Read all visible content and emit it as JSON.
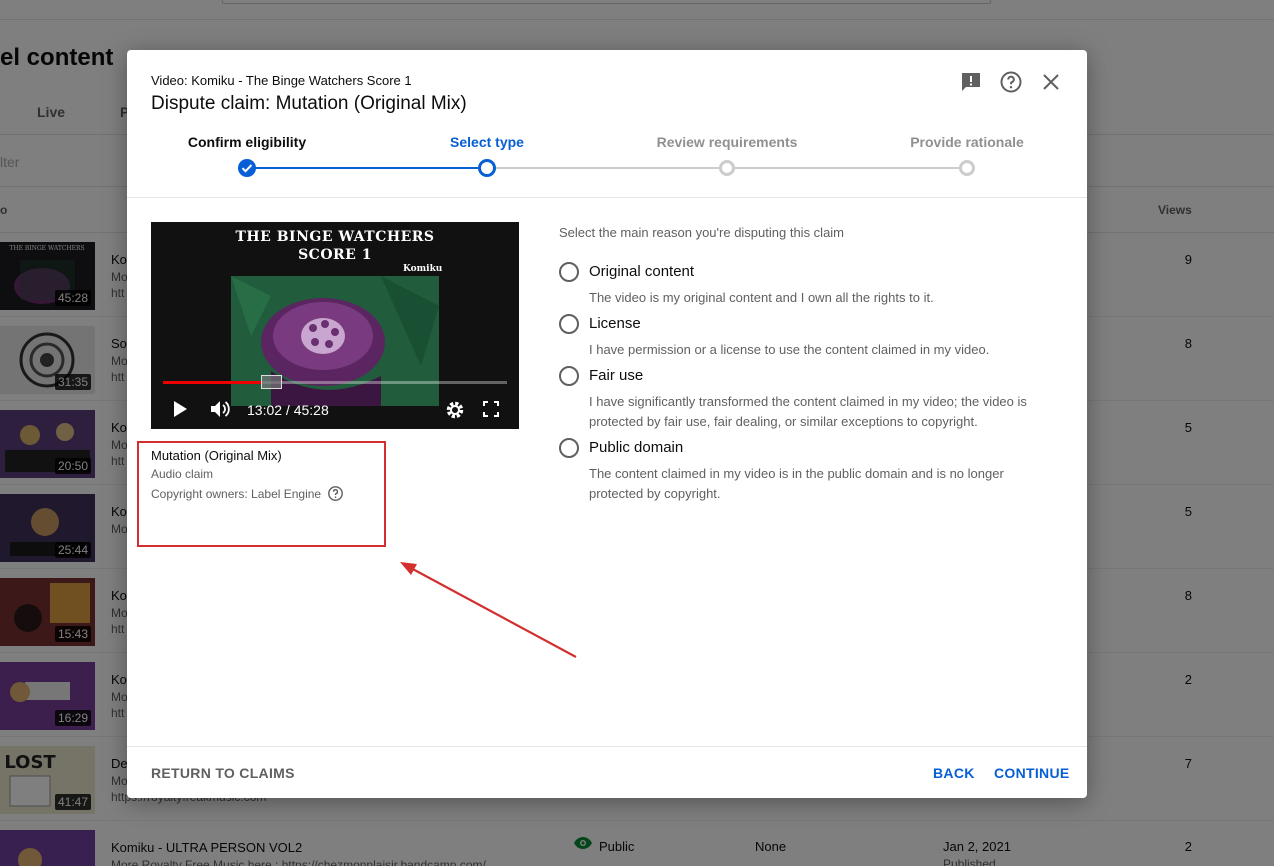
{
  "background": {
    "page_title": "el content",
    "tabs": [
      "Live",
      "P"
    ],
    "filter_placeholder": "lter",
    "columns": {
      "video": "o",
      "views": "Views"
    },
    "rows": [
      {
        "thumb_duration": "45:28",
        "title": "Ko",
        "desc": "Mo",
        "link": "htt",
        "views": "9"
      },
      {
        "thumb_duration": "31:35",
        "title": "So",
        "desc": "Mo",
        "link": "htt",
        "views": "8"
      },
      {
        "thumb_duration": "20:50",
        "title": "Ko",
        "desc": "Mo",
        "link": "htt",
        "views": "5"
      },
      {
        "thumb_duration": "25:44",
        "title": "Ko",
        "desc": "Mo",
        "link": "",
        "views": "5"
      },
      {
        "thumb_duration": "15:43",
        "title": "Ko",
        "desc": "Mo",
        "link": "htt",
        "views": "8"
      },
      {
        "thumb_duration": "16:29",
        "title": "Ko",
        "desc": "Mo",
        "link": "htt",
        "views": "2"
      },
      {
        "thumb_duration": "41:47",
        "title": "De",
        "desc": "Mo",
        "link": "https://royaltyfreakmusic.com",
        "views": "7"
      },
      {
        "thumb_duration": "",
        "title": "Komiku - ULTRA PERSON VOL2",
        "desc": "More Royalty Free Music here : https://chezmonplaisir.bandcamp.com/",
        "link": "",
        "views": "2",
        "visibility": "Public",
        "restrictions": "None",
        "date": "Jan 2, 2021",
        "status": "Published"
      }
    ]
  },
  "dialog": {
    "subtitle": "Video: Komiku - The Binge Watchers Score 1",
    "title": "Dispute claim: Mutation (Original Mix)",
    "icons": [
      "feedback-icon",
      "help-icon",
      "close-icon"
    ],
    "steps": [
      {
        "label": "Confirm eligibility",
        "state": "done"
      },
      {
        "label": "Select type",
        "state": "active"
      },
      {
        "label": "Review requirements",
        "state": "todo"
      },
      {
        "label": "Provide rationale",
        "state": "todo"
      }
    ],
    "video": {
      "title_line1": "THE BINGE WATCHERS",
      "title_line2": "SCORE 1",
      "author": "Komiku",
      "time": "13:02 / 45:28",
      "progress": 0.289
    },
    "claim": {
      "title": "Mutation (Original Mix)",
      "type": "Audio claim",
      "owners": "Copyright owners: Label Engine"
    },
    "prompt": "Select the main reason you're disputing this claim",
    "options": [
      {
        "label": "Original content",
        "desc": "The video is my original content and I own all the rights to it."
      },
      {
        "label": "License",
        "desc": "I have permission or a license to use the content claimed in my video."
      },
      {
        "label": "Fair use",
        "desc": "I have significantly transformed the content claimed in my video; the video is protected by fair use, fair dealing, or similar exceptions to copyright."
      },
      {
        "label": "Public domain",
        "desc": "The content claimed in my video is in the public domain and is no longer protected by copyright."
      }
    ],
    "buttons": {
      "return": "RETURN TO CLAIMS",
      "back": "BACK",
      "continue": "CONTINUE"
    }
  },
  "colors": {
    "accent": "#065fd4",
    "highlight": "#d32f2f",
    "progress": "#ee0000"
  }
}
